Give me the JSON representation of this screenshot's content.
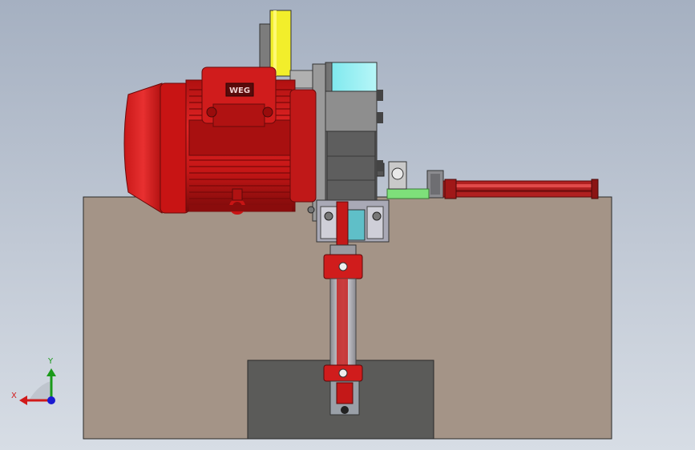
{
  "viewport": {
    "background_top": "#a5b0c1",
    "background_bottom": "#d7dde5"
  },
  "motor": {
    "brand": "WEG",
    "color": "#d11a1a"
  },
  "coordinate_triad": {
    "x_label": "X",
    "y_label": "Y",
    "x_color": "#d11a1a",
    "y_color": "#1a9a1a",
    "z_color": "#1a1ad1"
  },
  "parts": [
    "base-block",
    "electric-motor",
    "gearbox",
    "flange-plate",
    "belt",
    "cylinder-rod",
    "bottom-pocket",
    "linear-rail"
  ]
}
